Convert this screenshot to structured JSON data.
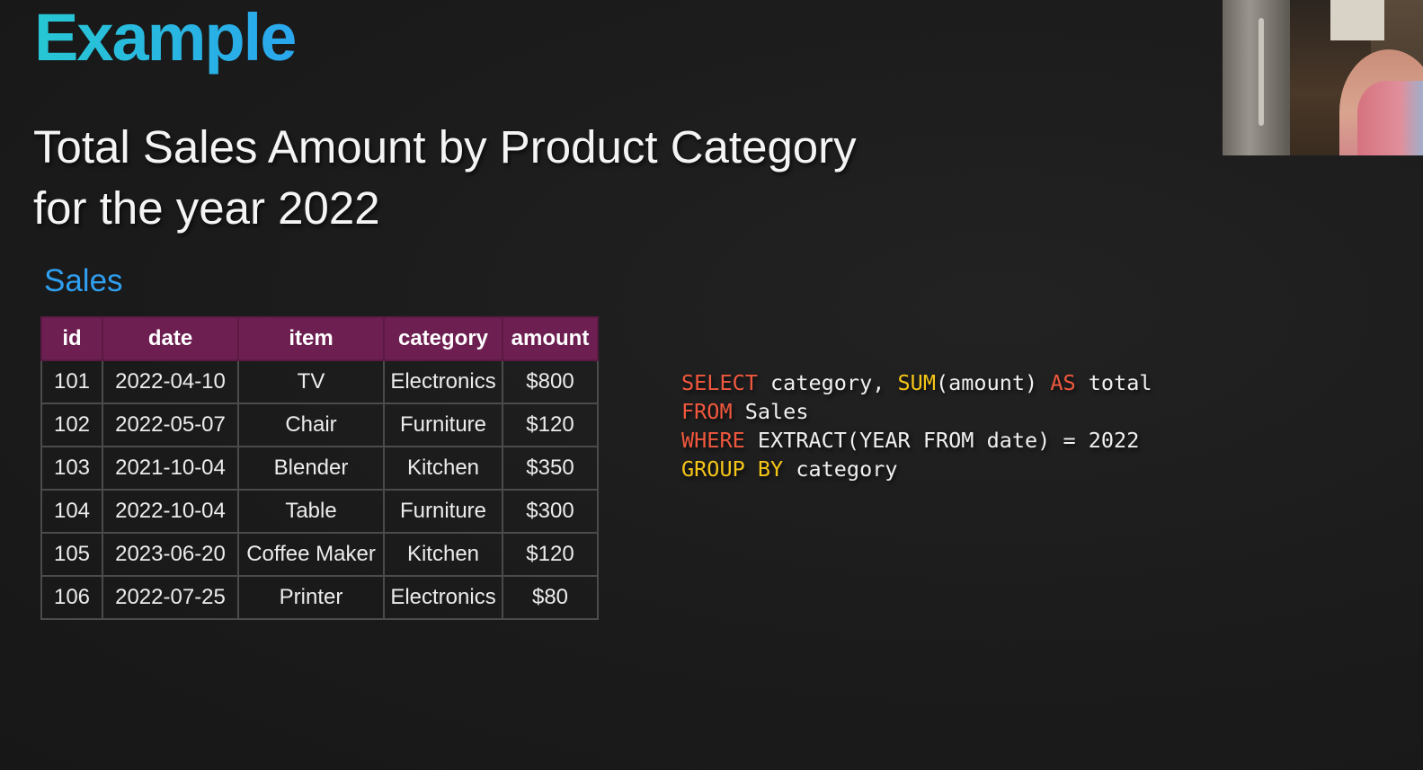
{
  "title": "Example",
  "subtitle": {
    "line1": "Total Sales Amount by Product Category",
    "line2": "for the year 2022"
  },
  "table": {
    "caption": "Sales",
    "headers": [
      "id",
      "date",
      "item",
      "category",
      "amount"
    ],
    "rows": [
      [
        "101",
        "2022-04-10",
        "TV",
        "Electronics",
        "$800"
      ],
      [
        "102",
        "2022-05-07",
        "Chair",
        "Furniture",
        "$120"
      ],
      [
        "103",
        "2021-10-04",
        "Blender",
        "Kitchen",
        "$350"
      ],
      [
        "104",
        "2022-10-04",
        "Table",
        "Furniture",
        "$300"
      ],
      [
        "105",
        "2023-06-20",
        "Coffee Maker",
        "Kitchen",
        "$120"
      ],
      [
        "106",
        "2022-07-25",
        "Printer",
        "Electronics",
        "$80"
      ]
    ]
  },
  "sql": {
    "line1": {
      "kw1": "SELECT",
      "t1": " category, ",
      "kw2": "SUM",
      "t2": "(amount) ",
      "kw3": "AS",
      "t3": " total"
    },
    "line2": {
      "kw1": "FROM",
      "t1": " Sales"
    },
    "line3": {
      "kw1": "WHERE",
      "t1": " EXTRACT(YEAR FROM date) = 2022"
    },
    "line4": {
      "kw1": "GROUP BY",
      "t1": " category"
    }
  },
  "colors": {
    "title_gradient_start": "#27c7d3",
    "title_gradient_end": "#2aa7ee",
    "caption": "#2f9ff0",
    "table_header_bg": "#6e1f51",
    "sql_keyword_red": "#f0583e",
    "sql_keyword_yellow": "#f5c518",
    "background": "#1b1b1b"
  }
}
